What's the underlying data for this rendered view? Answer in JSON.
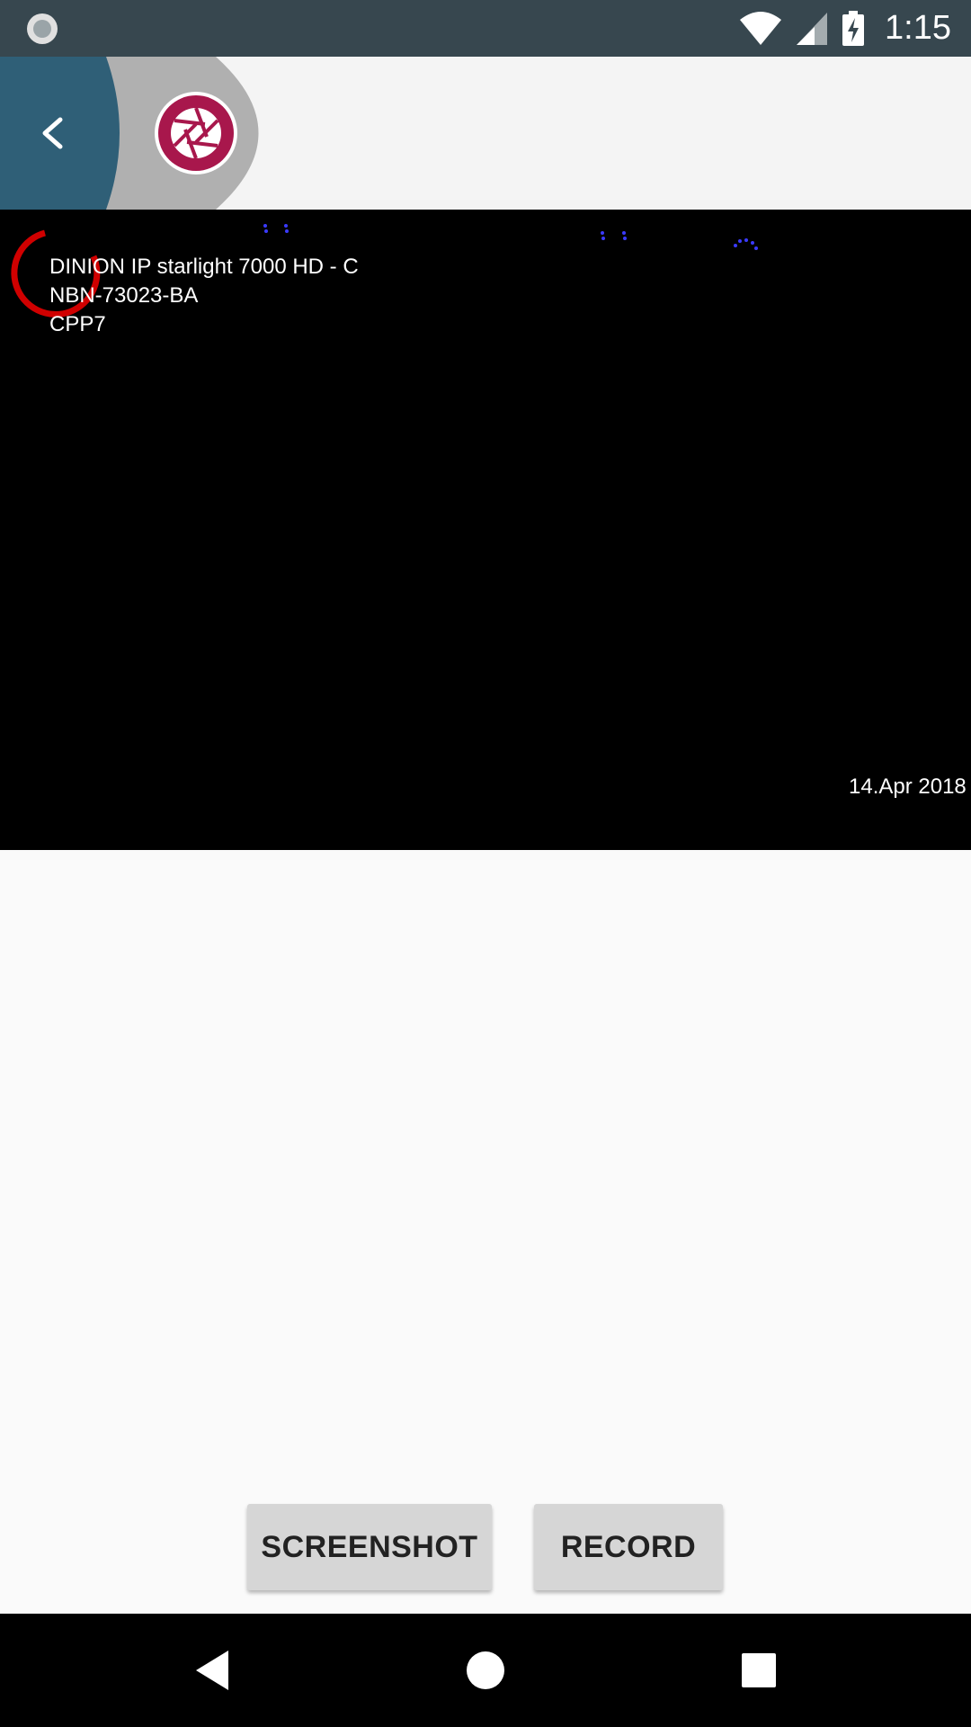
{
  "status_bar": {
    "time": "1:15",
    "icons": [
      "notification-dot-icon",
      "wifi-icon",
      "cell-signal-icon",
      "battery-charging-icon"
    ]
  },
  "header": {
    "back_icon": "chevron-left-icon",
    "logo_icon": "aperture-icon",
    "colors": {
      "back_bg": "#2f5f77",
      "shape_bg": "#b0b0b0",
      "logo": "#a8174c"
    }
  },
  "video": {
    "overlay_lines": [
      "DINION IP starlight 7000 HD - C",
      "NBN-73023-BA",
      "CPP7"
    ],
    "timestamp": "14.Apr 2018",
    "loading_icon": "loading-spinner-icon"
  },
  "actions": {
    "screenshot_label": "SCREENSHOT",
    "record_label": "RECORD"
  },
  "nav_bar": {
    "icons": [
      "nav-back-icon",
      "nav-home-icon",
      "nav-recents-icon"
    ]
  }
}
